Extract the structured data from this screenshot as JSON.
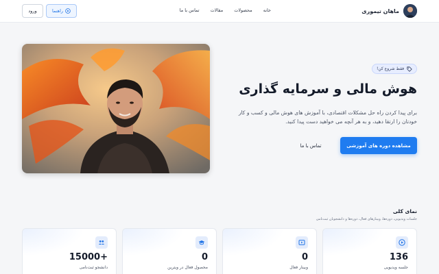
{
  "header": {
    "brand_name": "ماهان تیموری",
    "nav": [
      "خانه",
      "محصولات",
      "مقالات",
      "تماس با ما"
    ],
    "guide_label": "راهنما",
    "login_label": "ورود"
  },
  "hero": {
    "tag": "فقط شروع کن!",
    "title": "هوش مالی و سرمایه گذاری",
    "description": "برای پیدا کردن راه حل مشکلات اقتصادی، با آموزش های هوش مالی و کسب و کار خودتان را ارتقا دهید، و به هر آنچه می خواهید دست پیدا کنید.",
    "primary_cta": "مشاهده دوره های آموزشی",
    "secondary_cta": "تماس با ما"
  },
  "overview": {
    "title": "نمای کلی",
    "subtitle": "جلسات ویدیویی، دوره‌ها، وبینارهای فعال، دوره‌ها و دانشجویان ثبت‌نامی",
    "cards": [
      {
        "value": "136",
        "label": "جلسه ویدیویی",
        "icon": "video-icon"
      },
      {
        "value": "0",
        "label": "وبینار فعال",
        "icon": "webinar-icon"
      },
      {
        "value": "0",
        "label": "محصول فعال در ویترین",
        "icon": "graduation-cap-icon"
      },
      {
        "value": "15000+",
        "label": "دانشجو ثبت‌نامی",
        "icon": "students-icon"
      }
    ]
  },
  "colors": {
    "accent": "#1f7cf0",
    "background": "#f5f6f8",
    "tag_bg": "#e7edff"
  }
}
